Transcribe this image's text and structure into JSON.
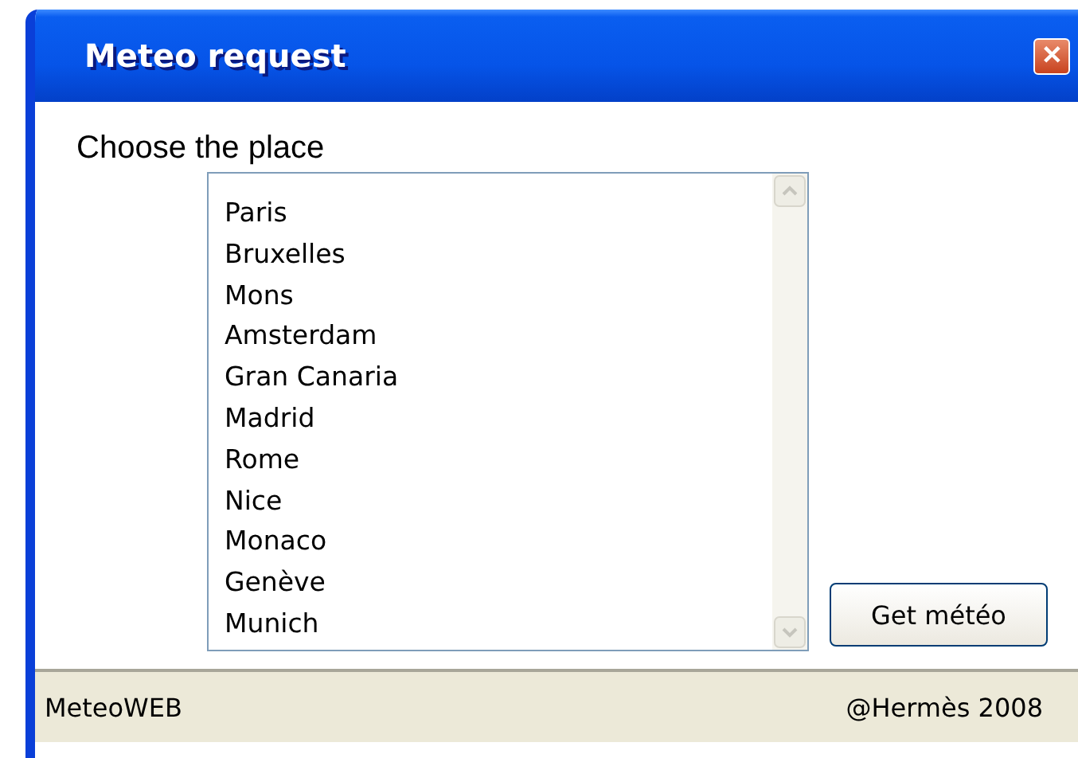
{
  "window": {
    "title": "Meteo request",
    "close_symbol": "✕"
  },
  "prompt": "Choose the place",
  "places": [
    "Paris",
    "Bruxelles",
    "Mons",
    "Amsterdam",
    "Gran Canaria",
    "Madrid",
    "Rome",
    "Nice",
    "Monaco",
    "Genève",
    "Munich"
  ],
  "button": "Get météo",
  "status_bar": {
    "left": "MeteoWEB",
    "right": "@Hermès 2008"
  }
}
